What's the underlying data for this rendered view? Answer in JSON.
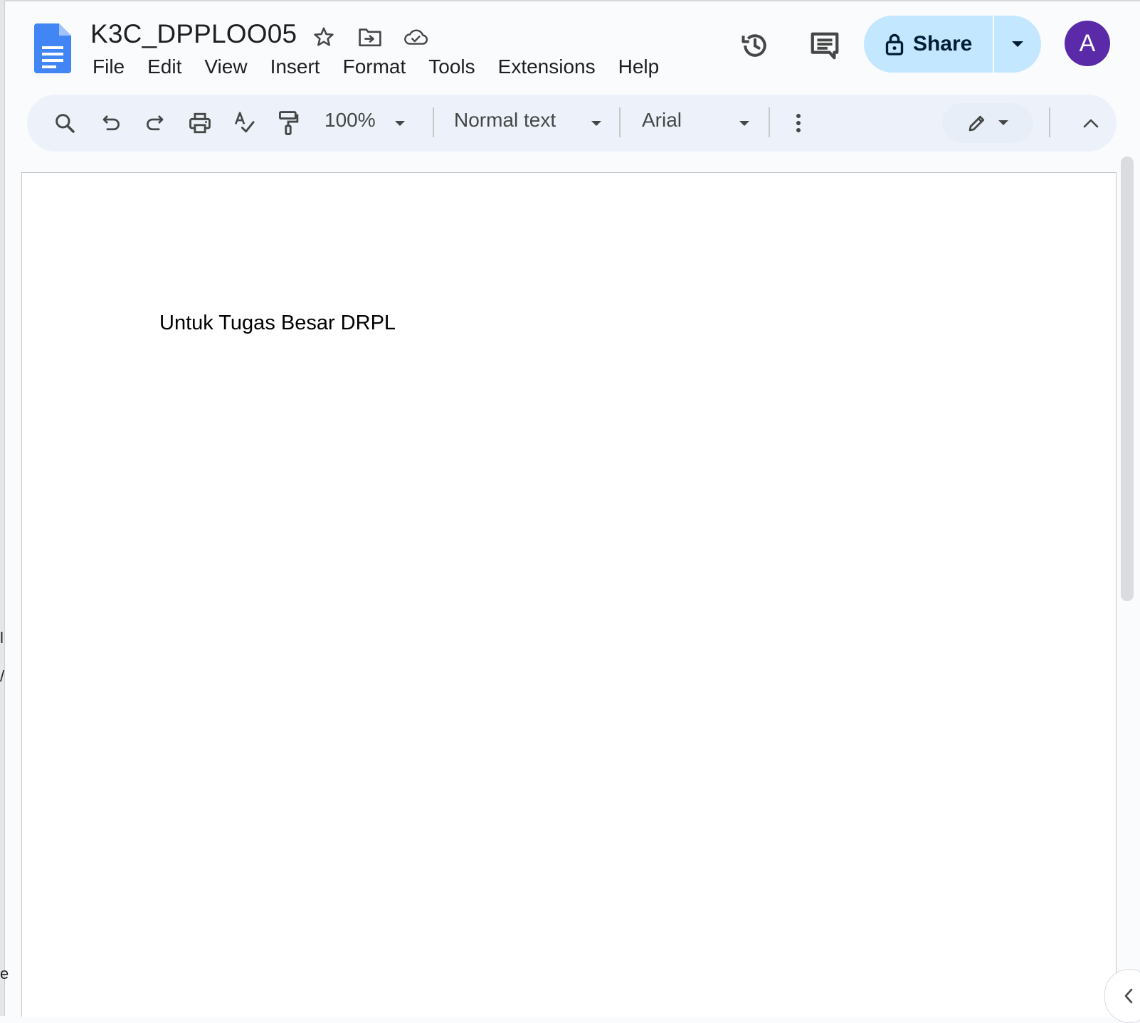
{
  "document": {
    "title": "K3C_DPPLOO05",
    "body_text": "Untuk Tugas Besar DRPL"
  },
  "title_icons": [
    "star-icon",
    "move-to-folder-icon",
    "cloud-saved-icon"
  ],
  "menu": [
    "File",
    "Edit",
    "View",
    "Insert",
    "Format",
    "Tools",
    "Extensions",
    "Help"
  ],
  "header": {
    "share_label": "Share",
    "avatar_initial": "A",
    "icons": [
      "version-history-icon",
      "comments-icon",
      "lock-icon",
      "share-dropdown-icon"
    ]
  },
  "toolbar": {
    "zoom": "100%",
    "style": "Normal text",
    "font": "Arial",
    "icons": [
      "search-icon",
      "undo-icon",
      "redo-icon",
      "print-icon",
      "spellcheck-icon",
      "paint-format-icon",
      "more-options-icon",
      "edit-mode-icon",
      "collapse-menus-icon"
    ]
  },
  "colors": {
    "background": "#f9fbfd",
    "toolbar": "#edf2fa",
    "share_button": "#c2e7ff",
    "avatar": "#5b2aa8",
    "docs_blue": "#4285f4"
  }
}
